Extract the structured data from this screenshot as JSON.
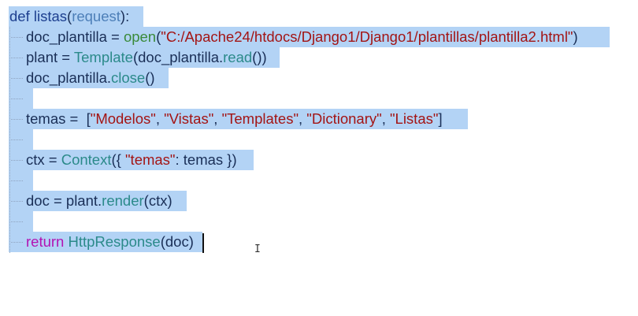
{
  "code": {
    "line1": {
      "def": "def",
      "fname": "listas",
      "lparen": "(",
      "param": "request",
      "rparen": "):"
    },
    "line2": {
      "var": "doc_plantilla = ",
      "fn": "open",
      "lp": "(",
      "str": "\"C:/Apache24/htdocs/Django1/Django1/plantillas/plantilla2.html\"",
      "rp": ")"
    },
    "line3": {
      "var": "plant = ",
      "cls": "Template",
      "lp": "(",
      "obj": "doc_plantilla.",
      "method": "read",
      "rp": "())"
    },
    "line4": {
      "obj": "doc_plantilla.",
      "method": "close",
      "rp": "()"
    },
    "line6": {
      "var": "temas =  [",
      "s1": "\"Modelos\"",
      "c1": ", ",
      "s2": "\"Vistas\"",
      "c2": ", ",
      "s3": "\"Templates\"",
      "c3": ", ",
      "s4": "\"Dictionary\"",
      "c4": ", ",
      "s5": "\"Listas\"",
      "end": "]"
    },
    "line8": {
      "var": "ctx = ",
      "cls": "Context",
      "lp": "({ ",
      "str": "\"temas\"",
      "rest": ": temas })"
    },
    "line10": {
      "var": "doc = plant.",
      "method": "render",
      "rest": "(ctx)"
    },
    "line12": {
      "kw": "return",
      "sp": " ",
      "cls": "HttpResponse",
      "rest": "(doc)"
    }
  },
  "colors": {
    "selection": "#b3d3f5",
    "keyword_return": "#b314b3",
    "string": "#a31515",
    "builtin": "#3a8a3a",
    "class": "#2b8a8a"
  },
  "icons": {
    "cursor": "i-beam-cursor-icon"
  }
}
